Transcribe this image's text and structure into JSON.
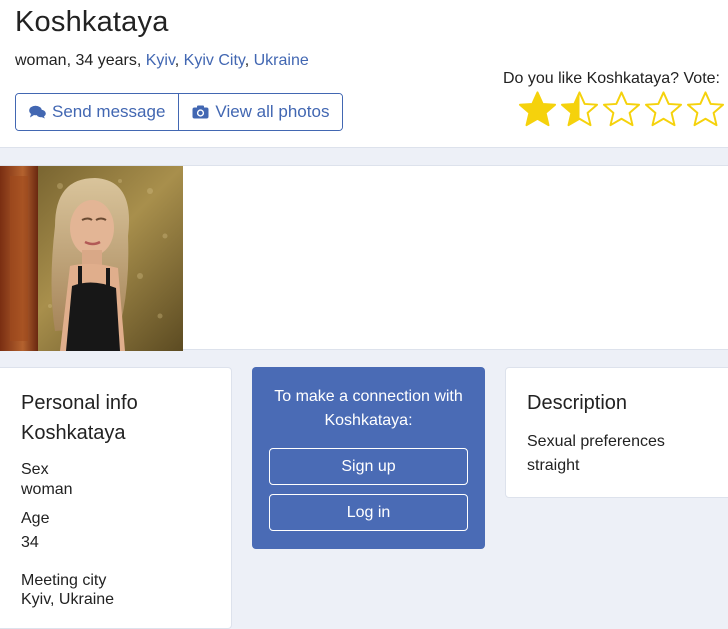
{
  "profile": {
    "name": "Koshkataya",
    "meta_prefix": "woman, 34 years, ",
    "city": "Kyiv",
    "region": "Kyiv City",
    "country": "Ukraine",
    "sep1": ", ",
    "sep2": ", "
  },
  "actions": {
    "send_message": "Send message",
    "view_photos": "View all photos",
    "send_icon": "chat-bubbles-icon",
    "photos_icon": "camera-icon"
  },
  "vote": {
    "label": "Do you like Koshkataya? Vote:",
    "rating": 1.5,
    "max": 5,
    "star_color": "#f5d20c"
  },
  "photos": {
    "count_shown": 1
  },
  "personal": {
    "title": "Personal info",
    "name": "Koshkataya",
    "sex_label": "Sex",
    "sex_value": "woman",
    "age_label": "Age",
    "age_value": "34",
    "city_label": "Meeting city",
    "city_value": "Kyiv, Ukraine"
  },
  "connect": {
    "text_line1": "To make a connection with",
    "text_line2": "Koshkataya:",
    "signup": "Sign up",
    "login": "Log in",
    "bg_color": "#4a6bb5"
  },
  "description": {
    "title": "Description",
    "line1": "Sexual preferences",
    "line2": "straight"
  },
  "colors": {
    "link": "#4267b2",
    "page_bg": "#edf0f7"
  }
}
